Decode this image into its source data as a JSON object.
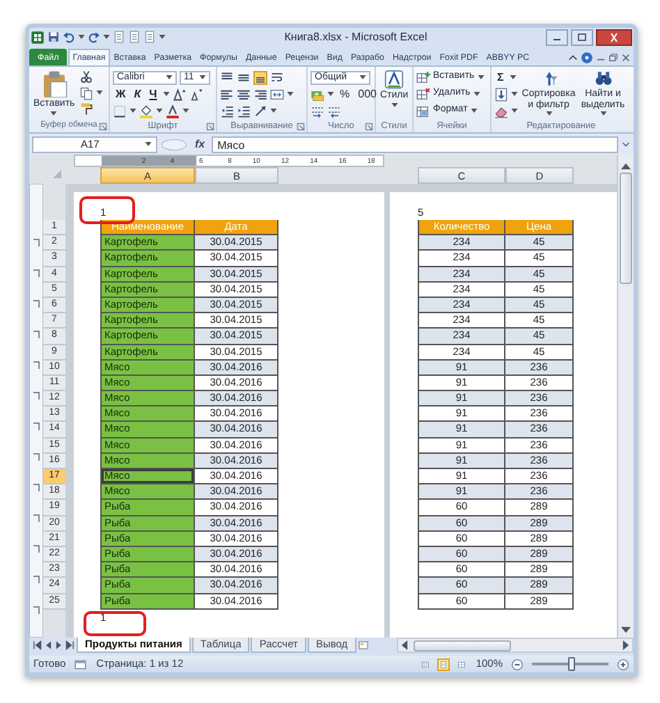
{
  "window": {
    "title": "Книга8.xlsx - Microsoft Excel"
  },
  "ribbon_tabs": [
    {
      "label": "Файл",
      "kind": "file",
      "selected": false
    },
    {
      "label": "Главная",
      "kind": "tab",
      "selected": true
    },
    {
      "label": "Вставка",
      "kind": "tab",
      "selected": false
    },
    {
      "label": "Разметка",
      "kind": "tab",
      "selected": false
    },
    {
      "label": "Формулы",
      "kind": "tab",
      "selected": false
    },
    {
      "label": "Данные",
      "kind": "tab",
      "selected": false
    },
    {
      "label": "Рецензи",
      "kind": "tab",
      "selected": false
    },
    {
      "label": "Вид",
      "kind": "tab",
      "selected": false
    },
    {
      "label": "Разрабо",
      "kind": "tab",
      "selected": false
    },
    {
      "label": "Надстрои",
      "kind": "tab",
      "selected": false
    },
    {
      "label": "Foxit PDF",
      "kind": "tab",
      "selected": false
    },
    {
      "label": "ABBYY PC",
      "kind": "tab",
      "selected": false
    }
  ],
  "ribbon_groups": [
    {
      "label": "Буфер обмена",
      "buttons": [
        "Вставить"
      ]
    },
    {
      "label": "Шрифт",
      "fields": [
        "Calibri",
        "11"
      ],
      "buttons": [
        "Ж",
        "К",
        "Ч"
      ]
    },
    {
      "label": "Выравнивание",
      "vertical_align": [
        {
          "selected": false
        },
        {
          "selected": false
        },
        {
          "selected": true
        }
      ]
    },
    {
      "label": "Число",
      "fields": [
        "Общий"
      ],
      "buttons": [
        "%",
        "000"
      ]
    },
    {
      "label": "Стили",
      "buttons": [
        "Стили"
      ]
    },
    {
      "label": "Ячейки",
      "buttons": [
        "Вставить",
        "Удалить",
        "Формат"
      ]
    },
    {
      "label": "Редактирование",
      "buttons": [
        "Σ",
        "Сортировка и фильтр",
        "Найти и выделить"
      ]
    }
  ],
  "formula_bar": {
    "name_box": "A17",
    "function_label": "fx",
    "formula": "Мясо"
  },
  "ruler_ticks": [
    "2",
    "4",
    "6",
    "8",
    "10",
    "12",
    "14",
    "16",
    "18"
  ],
  "columns": [
    {
      "label": "A",
      "selected": true
    },
    {
      "label": "B",
      "selected": false
    },
    {
      "label": "C",
      "selected": false
    },
    {
      "label": "D",
      "selected": false
    }
  ],
  "pages": [
    {
      "header_mark": "1",
      "footer_mark": "1",
      "highlighted": true
    },
    {
      "header_mark": "5"
    }
  ],
  "rows": [
    {
      "number": "1",
      "kind": "header",
      "selected": false,
      "cells": [
        "Наименование",
        "Дата",
        "Количество",
        "Цена"
      ]
    },
    {
      "number": "2",
      "kind": "data",
      "selected": false,
      "cells": [
        "Картофель",
        "30.04.2015",
        "234",
        "45"
      ]
    },
    {
      "number": "3",
      "kind": "data",
      "selected": false,
      "cells": [
        "Картофель",
        "30.04.2015",
        "234",
        "45"
      ]
    },
    {
      "number": "4",
      "kind": "data",
      "selected": false,
      "cells": [
        "Картофель",
        "30.04.2015",
        "234",
        "45"
      ]
    },
    {
      "number": "5",
      "kind": "data",
      "selected": false,
      "cells": [
        "Картофель",
        "30.04.2015",
        "234",
        "45"
      ]
    },
    {
      "number": "6",
      "kind": "data",
      "selected": false,
      "cells": [
        "Картофель",
        "30.04.2015",
        "234",
        "45"
      ]
    },
    {
      "number": "7",
      "kind": "data",
      "selected": false,
      "cells": [
        "Картофель",
        "30.04.2015",
        "234",
        "45"
      ]
    },
    {
      "number": "8",
      "kind": "data",
      "selected": false,
      "cells": [
        "Картофель",
        "30.04.2015",
        "234",
        "45"
      ]
    },
    {
      "number": "9",
      "kind": "data",
      "selected": false,
      "cells": [
        "Картофель",
        "30.04.2015",
        "234",
        "45"
      ]
    },
    {
      "number": "10",
      "kind": "data",
      "selected": false,
      "cells": [
        "Мясо",
        "30.04.2016",
        "91",
        "236"
      ]
    },
    {
      "number": "11",
      "kind": "data",
      "selected": false,
      "cells": [
        "Мясо",
        "30.04.2016",
        "91",
        "236"
      ]
    },
    {
      "number": "12",
      "kind": "data",
      "selected": false,
      "cells": [
        "Мясо",
        "30.04.2016",
        "91",
        "236"
      ]
    },
    {
      "number": "13",
      "kind": "data",
      "selected": false,
      "cells": [
        "Мясо",
        "30.04.2016",
        "91",
        "236"
      ]
    },
    {
      "number": "14",
      "kind": "data",
      "selected": false,
      "cells": [
        "Мясо",
        "30.04.2016",
        "91",
        "236"
      ]
    },
    {
      "number": "15",
      "kind": "data",
      "selected": false,
      "cells": [
        "Мясо",
        "30.04.2016",
        "91",
        "236"
      ]
    },
    {
      "number": "16",
      "kind": "data",
      "selected": false,
      "cells": [
        "Мясо",
        "30.04.2016",
        "91",
        "236"
      ]
    },
    {
      "number": "17",
      "kind": "data",
      "selected": true,
      "cells": [
        "Мясо",
        "30.04.2016",
        "91",
        "236"
      ]
    },
    {
      "number": "18",
      "kind": "data",
      "selected": false,
      "cells": [
        "Мясо",
        "30.04.2016",
        "91",
        "236"
      ]
    },
    {
      "number": "19",
      "kind": "data",
      "selected": false,
      "cells": [
        "Рыба",
        "30.04.2016",
        "60",
        "289"
      ]
    },
    {
      "number": "20",
      "kind": "data",
      "selected": false,
      "cells": [
        "Рыба",
        "30.04.2016",
        "60",
        "289"
      ]
    },
    {
      "number": "21",
      "kind": "data",
      "selected": false,
      "cells": [
        "Рыба",
        "30.04.2016",
        "60",
        "289"
      ]
    },
    {
      "number": "22",
      "kind": "data",
      "selected": false,
      "cells": [
        "Рыба",
        "30.04.2016",
        "60",
        "289"
      ]
    },
    {
      "number": "23",
      "kind": "data",
      "selected": false,
      "cells": [
        "Рыба",
        "30.04.2016",
        "60",
        "289"
      ]
    },
    {
      "number": "24",
      "kind": "data",
      "selected": false,
      "cells": [
        "Рыба",
        "30.04.2016",
        "60",
        "289"
      ]
    },
    {
      "number": "25",
      "kind": "data",
      "selected": false,
      "cells": [
        "Рыба",
        "30.04.2016",
        "60",
        "289"
      ]
    }
  ],
  "sheet_tabs": [
    {
      "label": "Продукты питания",
      "selected": true
    },
    {
      "label": "Таблица",
      "selected": false
    },
    {
      "label": "Рассчет",
      "selected": false
    },
    {
      "label": "Вывод",
      "selected": false
    }
  ],
  "status_bar": {
    "text": "Готово",
    "page_info": "Страница: 1 из 12",
    "views": [
      {
        "selected": false
      },
      {
        "selected": true
      },
      {
        "selected": false
      }
    ],
    "zoom_label": "100%",
    "zoom": {
      "level": 0.5
    }
  }
}
